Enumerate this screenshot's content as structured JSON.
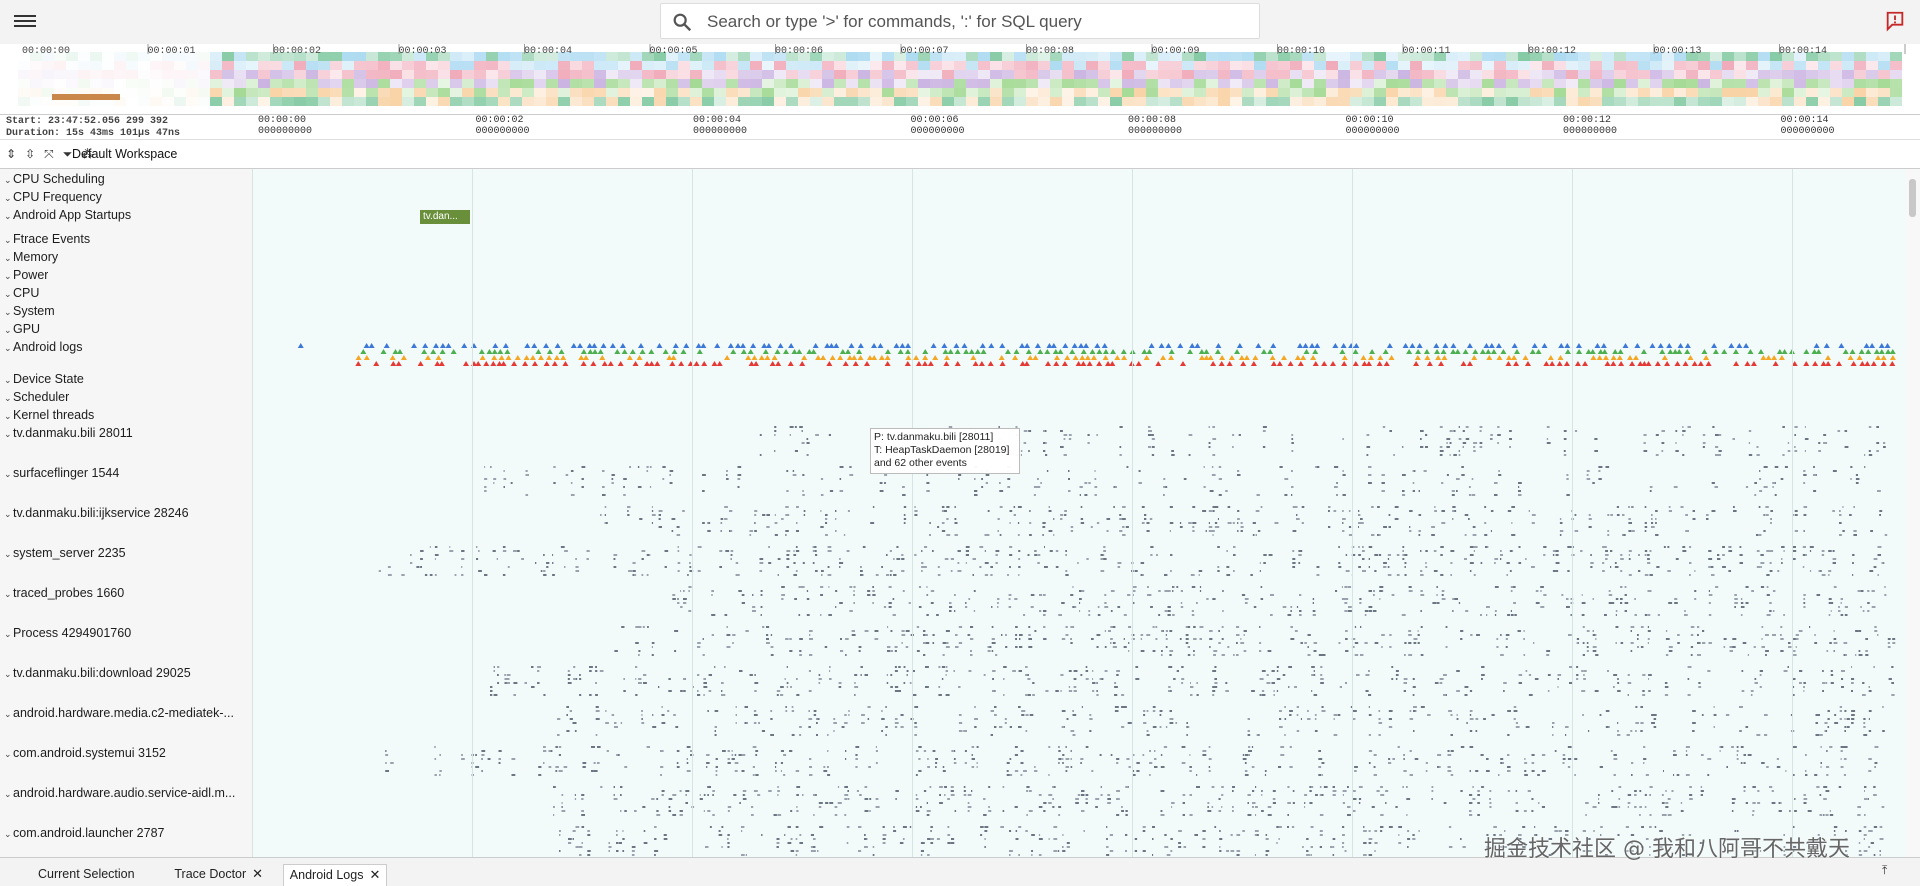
{
  "search": {
    "placeholder": "Search or type '>' for commands, ':' for SQL query"
  },
  "icons": {
    "menu": "hamburger-menu-icon",
    "search": "search-icon",
    "alert": "alert-flag-icon"
  },
  "overview_ticks": [
    "00:00:00",
    "00:00:01",
    "00:00:02",
    "00:00:03",
    "00:00:04",
    "00:00:05",
    "00:00:06",
    "00:00:07",
    "00:00:08",
    "00:00:09",
    "00:00:10",
    "00:00:11",
    "00:00:12",
    "00:00:13",
    "00:00:14"
  ],
  "ruler": {
    "start": "Start: 23:47:52.056 299 392",
    "duration": "Duration: 15s 43ms 101μs 47ns",
    "ticks": [
      {
        "top": "00:00:00",
        "bottom": "000000000"
      },
      {
        "top": "00:00:02",
        "bottom": "000000000"
      },
      {
        "top": "00:00:04",
        "bottom": "000000000"
      },
      {
        "top": "00:00:06",
        "bottom": "000000000"
      },
      {
        "top": "00:00:08",
        "bottom": "000000000"
      },
      {
        "top": "00:00:10",
        "bottom": "000000000"
      },
      {
        "top": "00:00:12",
        "bottom": "000000000"
      },
      {
        "top": "00:00:14",
        "bottom": "000000000"
      }
    ]
  },
  "workspace": {
    "name": "Default Workspace",
    "icons": [
      "expand-all-icon",
      "collapse-all-icon",
      "unpin-icon",
      "filter-icon",
      "workspace-icon"
    ]
  },
  "tracks": [
    {
      "title": "CPU Scheduling",
      "kind": "group"
    },
    {
      "title": "CPU Frequency",
      "kind": "group"
    },
    {
      "title": "Android App Startups",
      "kind": "startup",
      "slice_label": "tv.dan..."
    },
    {
      "title": "Ftrace Events",
      "kind": "group"
    },
    {
      "title": "Memory",
      "kind": "group"
    },
    {
      "title": "Power",
      "kind": "group"
    },
    {
      "title": "CPU",
      "kind": "group"
    },
    {
      "title": "System",
      "kind": "group"
    },
    {
      "title": "GPU",
      "kind": "group"
    },
    {
      "title": "Android logs",
      "kind": "logs"
    },
    {
      "title": "Device State",
      "kind": "group"
    },
    {
      "title": "Scheduler",
      "kind": "group"
    },
    {
      "title": "Kernel threads",
      "kind": "group"
    },
    {
      "title": "tv.danmaku.bili 28011",
      "kind": "process"
    },
    {
      "title": "surfaceflinger 1544",
      "kind": "process"
    },
    {
      "title": "tv.danmaku.bili:ijkservice 28246",
      "kind": "process"
    },
    {
      "title": "system_server 2235",
      "kind": "process"
    },
    {
      "title": "traced_probes 1660",
      "kind": "process"
    },
    {
      "title": "Process 4294901760",
      "kind": "process"
    },
    {
      "title": "tv.danmaku.bili:download 29025",
      "kind": "process"
    },
    {
      "title": "android.hardware.media.c2-mediatek-...",
      "kind": "process"
    },
    {
      "title": "com.android.systemui 3152",
      "kind": "process"
    },
    {
      "title": "android.hardware.audio.service-aidl.m...",
      "kind": "process"
    },
    {
      "title": "com.android.launcher 2787",
      "kind": "process"
    }
  ],
  "tooltip": {
    "line1": "P: tv.danmaku.bili [28011]",
    "line2": "T: HeapTaskDaemon [28019]",
    "line3": "and 62 other events"
  },
  "bottom_tabs": [
    {
      "label": "Current Selection",
      "closable": false,
      "active": false
    },
    {
      "label": "Trace Doctor",
      "closable": true,
      "active": false
    },
    {
      "label": "Android Logs",
      "closable": true,
      "active": true
    }
  ],
  "close_glyph": "✕",
  "watermark": "掘金技术社区 @ 我和八阿哥不共戴天",
  "colors": {
    "log_levels": [
      "#3c78d8",
      "#4caf50",
      "#f5a623",
      "#e53935"
    ],
    "startup_slice": "#6a8f3a",
    "lane_bg": "#f2fafa"
  }
}
